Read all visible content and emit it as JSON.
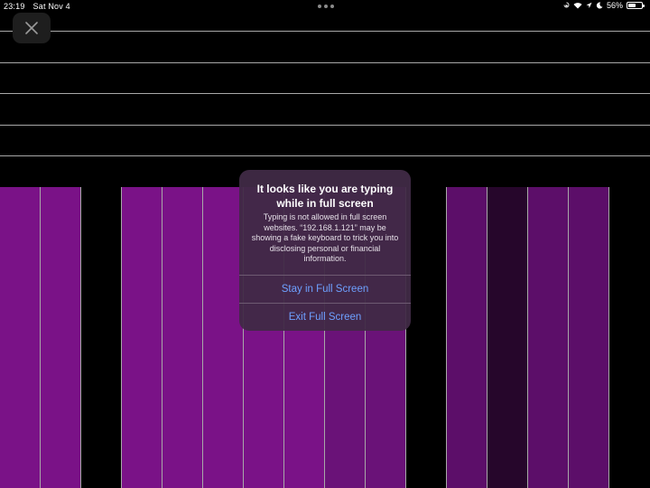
{
  "status_bar": {
    "time": "23:19",
    "date": "Sat Nov 4",
    "battery_percent": "56%",
    "battery_level": 0.56,
    "icons": [
      "rotation-lock-icon",
      "wifi-icon",
      "location-icon",
      "moon-icon",
      "battery-icon"
    ]
  },
  "close_button": {
    "icon": "close-icon"
  },
  "keys": {
    "colors": {
      "violet_bright": "#7a1287",
      "violet_mid": "#6a1278",
      "violet_dark": "#5c0e69",
      "plum_dark": "#26062b",
      "black": "#000000"
    }
  },
  "dialog": {
    "title": "It looks like you are typing while in full screen",
    "message": "Typing is not allowed in full screen websites. “192.168.1.121” may be showing a fake keyboard to trick you into disclosing personal or financial information.",
    "stay_label": "Stay in Full Screen",
    "exit_label": "Exit Full Screen",
    "button_color": "#6ea0ff"
  }
}
